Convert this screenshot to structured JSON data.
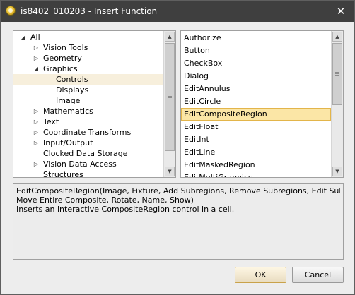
{
  "window": {
    "title": "is8402_010203 - Insert Function",
    "icon": "function-icon",
    "close_glyph": "✕"
  },
  "tree": {
    "items": [
      {
        "label": "All",
        "level": 0,
        "state": "expanded"
      },
      {
        "label": "Vision Tools",
        "level": 1,
        "state": "collapsed"
      },
      {
        "label": "Geometry",
        "level": 1,
        "state": "collapsed"
      },
      {
        "label": "Graphics",
        "level": 1,
        "state": "expanded"
      },
      {
        "label": "Controls",
        "level": 2,
        "state": "leaf",
        "selected": true
      },
      {
        "label": "Displays",
        "level": 2,
        "state": "leaf"
      },
      {
        "label": "Image",
        "level": 2,
        "state": "leaf"
      },
      {
        "label": "Mathematics",
        "level": 1,
        "state": "collapsed"
      },
      {
        "label": "Text",
        "level": 1,
        "state": "collapsed"
      },
      {
        "label": "Coordinate Transforms",
        "level": 1,
        "state": "collapsed"
      },
      {
        "label": "Input/Output",
        "level": 1,
        "state": "collapsed"
      },
      {
        "label": "Clocked Data Storage",
        "level": 1,
        "state": "leaf"
      },
      {
        "label": "Vision Data Access",
        "level": 1,
        "state": "collapsed"
      },
      {
        "label": "Structures",
        "level": 1,
        "state": "leaf"
      }
    ]
  },
  "functions": {
    "items": [
      "Authorize",
      "Button",
      "CheckBox",
      "Dialog",
      "EditAnnulus",
      "EditCircle",
      "EditCompositeRegion",
      "EditFloat",
      "EditInt",
      "EditLine",
      "EditMaskedRegion",
      "EditMultiGraphics"
    ],
    "selected": "EditCompositeRegion"
  },
  "description": {
    "lines": [
      "EditCompositeRegion(Image, Fixture, Add Subregions, Remove Subregions, Edit Subregions,",
      "Move Entire Composite, Rotate, Name, Show)",
      "Inserts an interactive CompositeRegion control in a cell."
    ]
  },
  "buttons": {
    "ok_label": "OK",
    "cancel_label": "Cancel"
  },
  "colors": {
    "titlebar": "#3f3f3f",
    "selection_fill": "#fbe6a6",
    "selection_border": "#e3b54a",
    "tree_selection": "#f7efdc"
  }
}
